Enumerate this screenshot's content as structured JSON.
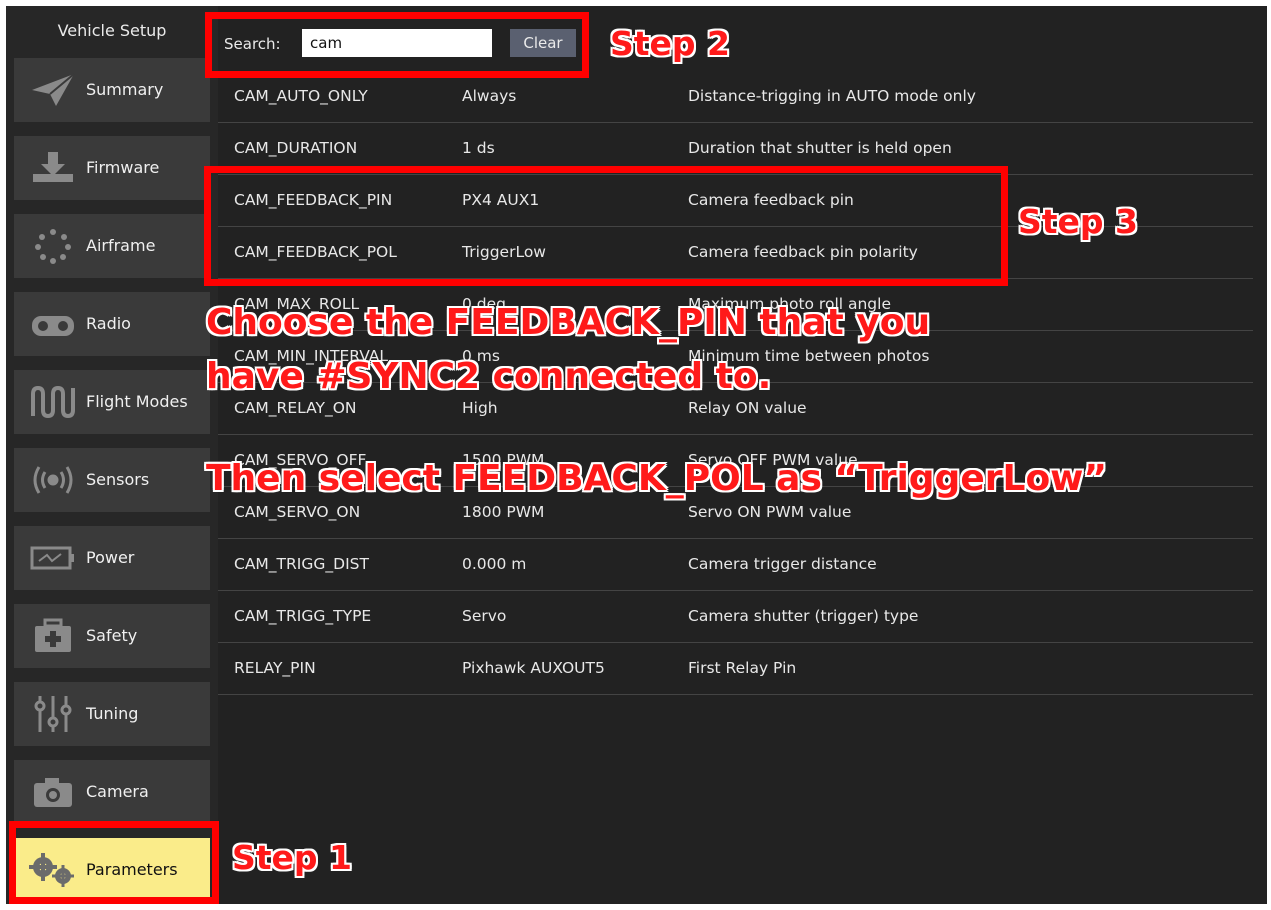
{
  "sidebar": {
    "title": "Vehicle Setup",
    "items": [
      {
        "label": "Summary",
        "icon": "paper-plane-icon"
      },
      {
        "label": "Firmware",
        "icon": "download-icon"
      },
      {
        "label": "Airframe",
        "icon": "dots-circle-icon"
      },
      {
        "label": "Radio",
        "icon": "radio-controller-icon"
      },
      {
        "label": "Flight Modes",
        "icon": "wave-icon"
      },
      {
        "label": "Sensors",
        "icon": "sensor-signal-icon"
      },
      {
        "label": "Power",
        "icon": "battery-icon"
      },
      {
        "label": "Safety",
        "icon": "first-aid-kit-icon"
      },
      {
        "label": "Tuning",
        "icon": "sliders-icon"
      },
      {
        "label": "Camera",
        "icon": "camera-icon"
      },
      {
        "label": "Parameters",
        "icon": "gears-icon",
        "active": true
      }
    ]
  },
  "search": {
    "label": "Search:",
    "value": "cam",
    "clear_label": "Clear"
  },
  "params": [
    {
      "name": "CAM_AUTO_ONLY",
      "value": "Always",
      "description": "Distance-trigging in AUTO mode only"
    },
    {
      "name": "CAM_DURATION",
      "value": "1 ds",
      "description": "Duration that shutter is held open"
    },
    {
      "name": "CAM_FEEDBACK_PIN",
      "value": "PX4 AUX1",
      "description": "Camera feedback pin"
    },
    {
      "name": "CAM_FEEDBACK_POL",
      "value": "TriggerLow",
      "description": "Camera feedback pin polarity"
    },
    {
      "name": "CAM_MAX_ROLL",
      "value": "0 deg",
      "description": "Maximum photo roll angle"
    },
    {
      "name": "CAM_MIN_INTERVAL",
      "value": "0 ms",
      "description": "Minimum time between photos"
    },
    {
      "name": "CAM_RELAY_ON",
      "value": "High",
      "description": "Relay ON value"
    },
    {
      "name": "CAM_SERVO_OFF",
      "value": "1500 PWM",
      "description": "Servo OFF PWM value"
    },
    {
      "name": "CAM_SERVO_ON",
      "value": "1800 PWM",
      "description": "Servo ON PWM value"
    },
    {
      "name": "CAM_TRIGG_DIST",
      "value": "0.000 m",
      "description": "Camera trigger distance"
    },
    {
      "name": "CAM_TRIGG_TYPE",
      "value": "Servo",
      "description": "Camera shutter (trigger) type"
    },
    {
      "name": "RELAY_PIN",
      "value": "Pixhawk AUXOUT5",
      "description": "First Relay Pin"
    }
  ],
  "annotations": {
    "step1": "Step 1",
    "step2": "Step 2",
    "step3": "Step 3",
    "instruction_line1": "Choose the FEEDBACK_PIN that you",
    "instruction_line2": "have #SYNC2 connected to.",
    "instruction_line3": "Then select FEEDBACK_POL as “TriggerLow”",
    "highlight_color": "#ff0000"
  },
  "colors": {
    "background": "#222222",
    "sidebar_button": "#3a3a3a",
    "active_button": "#faec8a",
    "clear_button": "#5a6070"
  }
}
